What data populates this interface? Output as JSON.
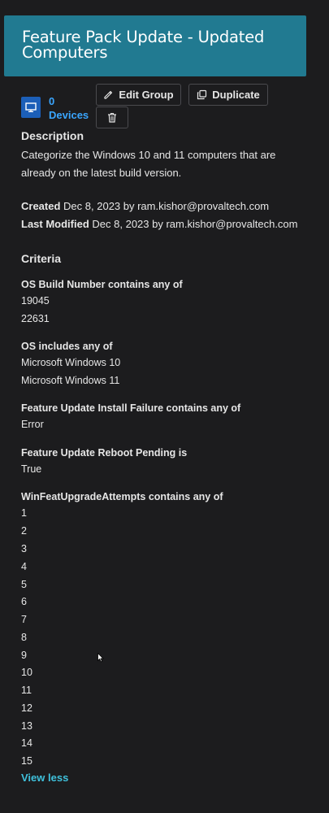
{
  "header": {
    "title": "Feature Pack Update - Updated Computers"
  },
  "devices": {
    "count": "0",
    "label": "Devices"
  },
  "buttons": {
    "edit": "Edit Group",
    "duplicate": "Duplicate"
  },
  "description": {
    "heading": "Description",
    "text": "Categorize the Windows 10 and 11 computers that are already on the latest build version."
  },
  "meta": {
    "created_label": "Created",
    "created_value": "Dec 8, 2023 by ram.kishor@provaltech.com",
    "modified_label": "Last Modified",
    "modified_value": "Dec 8, 2023 by ram.kishor@provaltech.com"
  },
  "criteria": {
    "heading": "Criteria",
    "groups": [
      {
        "label": "OS Build Number contains any of",
        "values": [
          "19045",
          "22631"
        ]
      },
      {
        "label": "OS includes any of",
        "values": [
          "Microsoft Windows 10",
          "Microsoft Windows 11"
        ]
      },
      {
        "label": "Feature Update Install Failure contains any of",
        "values": [
          "Error"
        ]
      },
      {
        "label": "Feature Update Reboot Pending is",
        "values": [
          "True"
        ]
      },
      {
        "label": "WinFeatUpgradeAttempts contains any of",
        "values": [
          "1",
          "2",
          "3",
          "4",
          "5",
          "6",
          "7",
          "8",
          "9",
          "10",
          "11",
          "12",
          "13",
          "14",
          "15"
        ]
      }
    ]
  },
  "view_less": "View less",
  "colors": {
    "header_bg": "#217a91",
    "link": "#3aa6ff",
    "accent": "#3fc1dc",
    "background": "#1c1c1e"
  }
}
